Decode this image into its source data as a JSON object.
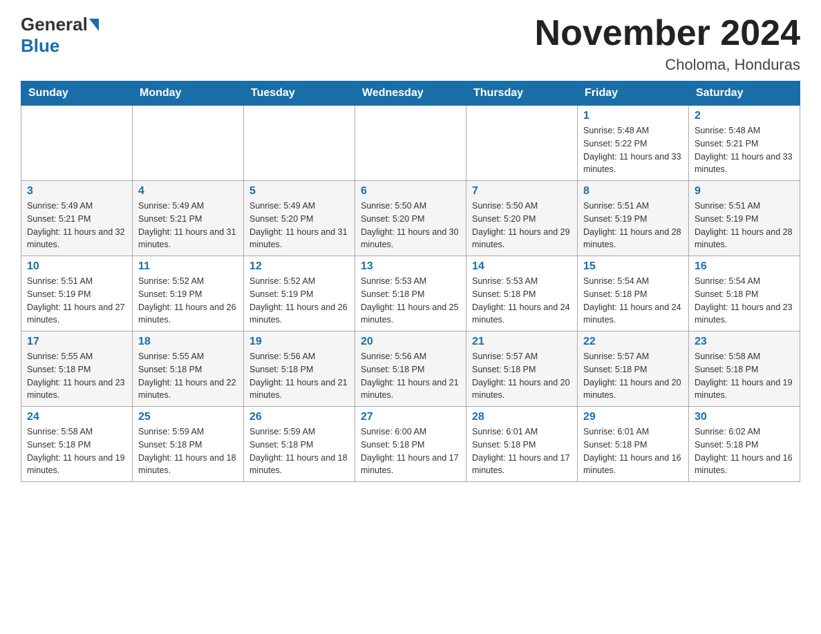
{
  "header": {
    "logo_general": "General",
    "logo_blue": "Blue",
    "month_title": "November 2024",
    "location": "Choloma, Honduras"
  },
  "weekdays": [
    "Sunday",
    "Monday",
    "Tuesday",
    "Wednesday",
    "Thursday",
    "Friday",
    "Saturday"
  ],
  "weeks": [
    [
      {
        "day": "",
        "info": ""
      },
      {
        "day": "",
        "info": ""
      },
      {
        "day": "",
        "info": ""
      },
      {
        "day": "",
        "info": ""
      },
      {
        "day": "",
        "info": ""
      },
      {
        "day": "1",
        "info": "Sunrise: 5:48 AM\nSunset: 5:22 PM\nDaylight: 11 hours and 33 minutes."
      },
      {
        "day": "2",
        "info": "Sunrise: 5:48 AM\nSunset: 5:21 PM\nDaylight: 11 hours and 33 minutes."
      }
    ],
    [
      {
        "day": "3",
        "info": "Sunrise: 5:49 AM\nSunset: 5:21 PM\nDaylight: 11 hours and 32 minutes."
      },
      {
        "day": "4",
        "info": "Sunrise: 5:49 AM\nSunset: 5:21 PM\nDaylight: 11 hours and 31 minutes."
      },
      {
        "day": "5",
        "info": "Sunrise: 5:49 AM\nSunset: 5:20 PM\nDaylight: 11 hours and 31 minutes."
      },
      {
        "day": "6",
        "info": "Sunrise: 5:50 AM\nSunset: 5:20 PM\nDaylight: 11 hours and 30 minutes."
      },
      {
        "day": "7",
        "info": "Sunrise: 5:50 AM\nSunset: 5:20 PM\nDaylight: 11 hours and 29 minutes."
      },
      {
        "day": "8",
        "info": "Sunrise: 5:51 AM\nSunset: 5:19 PM\nDaylight: 11 hours and 28 minutes."
      },
      {
        "day": "9",
        "info": "Sunrise: 5:51 AM\nSunset: 5:19 PM\nDaylight: 11 hours and 28 minutes."
      }
    ],
    [
      {
        "day": "10",
        "info": "Sunrise: 5:51 AM\nSunset: 5:19 PM\nDaylight: 11 hours and 27 minutes."
      },
      {
        "day": "11",
        "info": "Sunrise: 5:52 AM\nSunset: 5:19 PM\nDaylight: 11 hours and 26 minutes."
      },
      {
        "day": "12",
        "info": "Sunrise: 5:52 AM\nSunset: 5:19 PM\nDaylight: 11 hours and 26 minutes."
      },
      {
        "day": "13",
        "info": "Sunrise: 5:53 AM\nSunset: 5:18 PM\nDaylight: 11 hours and 25 minutes."
      },
      {
        "day": "14",
        "info": "Sunrise: 5:53 AM\nSunset: 5:18 PM\nDaylight: 11 hours and 24 minutes."
      },
      {
        "day": "15",
        "info": "Sunrise: 5:54 AM\nSunset: 5:18 PM\nDaylight: 11 hours and 24 minutes."
      },
      {
        "day": "16",
        "info": "Sunrise: 5:54 AM\nSunset: 5:18 PM\nDaylight: 11 hours and 23 minutes."
      }
    ],
    [
      {
        "day": "17",
        "info": "Sunrise: 5:55 AM\nSunset: 5:18 PM\nDaylight: 11 hours and 23 minutes."
      },
      {
        "day": "18",
        "info": "Sunrise: 5:55 AM\nSunset: 5:18 PM\nDaylight: 11 hours and 22 minutes."
      },
      {
        "day": "19",
        "info": "Sunrise: 5:56 AM\nSunset: 5:18 PM\nDaylight: 11 hours and 21 minutes."
      },
      {
        "day": "20",
        "info": "Sunrise: 5:56 AM\nSunset: 5:18 PM\nDaylight: 11 hours and 21 minutes."
      },
      {
        "day": "21",
        "info": "Sunrise: 5:57 AM\nSunset: 5:18 PM\nDaylight: 11 hours and 20 minutes."
      },
      {
        "day": "22",
        "info": "Sunrise: 5:57 AM\nSunset: 5:18 PM\nDaylight: 11 hours and 20 minutes."
      },
      {
        "day": "23",
        "info": "Sunrise: 5:58 AM\nSunset: 5:18 PM\nDaylight: 11 hours and 19 minutes."
      }
    ],
    [
      {
        "day": "24",
        "info": "Sunrise: 5:58 AM\nSunset: 5:18 PM\nDaylight: 11 hours and 19 minutes."
      },
      {
        "day": "25",
        "info": "Sunrise: 5:59 AM\nSunset: 5:18 PM\nDaylight: 11 hours and 18 minutes."
      },
      {
        "day": "26",
        "info": "Sunrise: 5:59 AM\nSunset: 5:18 PM\nDaylight: 11 hours and 18 minutes."
      },
      {
        "day": "27",
        "info": "Sunrise: 6:00 AM\nSunset: 5:18 PM\nDaylight: 11 hours and 17 minutes."
      },
      {
        "day": "28",
        "info": "Sunrise: 6:01 AM\nSunset: 5:18 PM\nDaylight: 11 hours and 17 minutes."
      },
      {
        "day": "29",
        "info": "Sunrise: 6:01 AM\nSunset: 5:18 PM\nDaylight: 11 hours and 16 minutes."
      },
      {
        "day": "30",
        "info": "Sunrise: 6:02 AM\nSunset: 5:18 PM\nDaylight: 11 hours and 16 minutes."
      }
    ]
  ]
}
